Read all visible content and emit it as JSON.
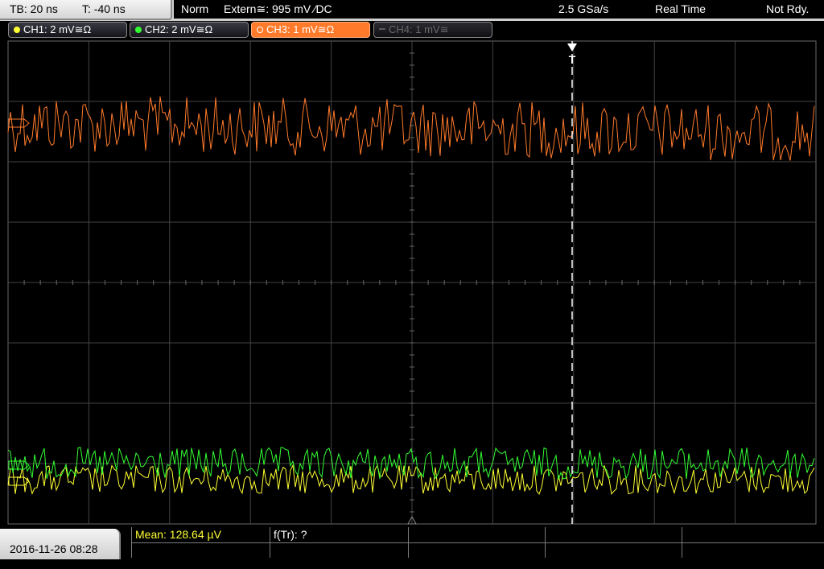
{
  "topbar": {
    "timebase": "TB: 20 ns",
    "trigger_pos": "T: -40 ns",
    "trigger_mode": "Norm",
    "trigger_source": "Extern≅: 995 mV ⁄DC",
    "sample_rate": "2.5 GSa/s",
    "acq_mode": "Real Time",
    "status": "Not Rdy."
  },
  "channels": [
    {
      "label": "CH1: 2 mV≅Ω",
      "color": "#ffff33"
    },
    {
      "label": "CH2: 2 mV≅Ω",
      "color": "#33ff33"
    },
    {
      "label": "CH3: 1 mV≅Ω",
      "color": "#ff7a2a"
    },
    {
      "label": "CH4: 1 mV≅",
      "color": "#5a5a5a"
    }
  ],
  "waveform_colors": {
    "ch1": "#ffff33",
    "ch2": "#33ff33",
    "ch3": "#ff7a2a",
    "grid": "#444444",
    "trigger": "#ffffff"
  },
  "trigger_marker_label": "T",
  "bottombar": {
    "datetime": "2016-11-26 08:28",
    "mean_label": "Mean: 128.64 µV",
    "freq_label": "f(Tr): ?"
  }
}
